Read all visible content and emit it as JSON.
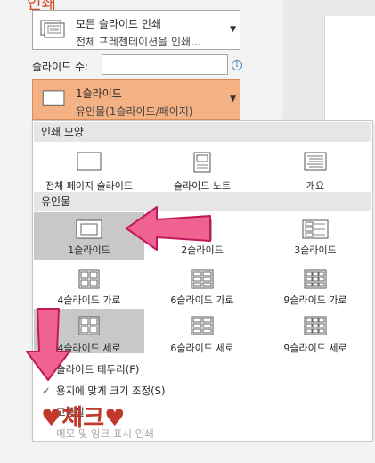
{
  "heading": {
    "text": "인쇄"
  },
  "layout_dropdown": {
    "title": "모든 슬라이드 인쇄",
    "subtitle": "전체 프레젠테이션을 인쇄...",
    "icon": "slides-stack-icon"
  },
  "copies": {
    "label": "슬라이드 수:",
    "value": "",
    "info_icon": "info-icon"
  },
  "handout_dropdown": {
    "title": "1슬라이드",
    "subtitle": "유인물(1슬라이드/페이지)",
    "icon": "single-slide-icon",
    "bg": "#f4b183"
  },
  "popup": {
    "section_print": "인쇄 모양",
    "print_options": [
      {
        "label": "전체 페이지 슬라이드",
        "icon": "full-slide-icon"
      },
      {
        "label": "슬라이드 노트",
        "icon": "notes-page-icon"
      },
      {
        "label": "개요",
        "icon": "outline-icon"
      }
    ],
    "section_handout": "유인물",
    "handout_options": [
      {
        "label": "1슬라이드",
        "icon": "one-slide-icon",
        "selected": true
      },
      {
        "label": "2슬라이드",
        "icon": "two-slides-icon"
      },
      {
        "label": "3슬라이드",
        "icon": "three-slides-icon"
      },
      {
        "label": "4슬라이드 가로",
        "icon": "four-slides-horizontal-icon"
      },
      {
        "label": "6슬라이드 가로",
        "icon": "six-slides-horizontal-icon"
      },
      {
        "label": "9슬라이드 가로",
        "icon": "nine-slides-horizontal-icon"
      },
      {
        "label": "4슬라이드 세로",
        "icon": "four-slides-vertical-icon",
        "selected": true
      },
      {
        "label": "6슬라이드 세로",
        "icon": "six-slides-vertical-icon"
      },
      {
        "label": "9슬라이드 세로",
        "icon": "nine-slides-vertical-icon"
      }
    ],
    "checkbox_options": [
      {
        "label": "슬라이드 테두리(F)",
        "checked": false
      },
      {
        "label": "용지에 맞게 크기 조정(S)",
        "checked": true
      },
      {
        "label": "고품질",
        "checked": false
      },
      {
        "label": "메모 및 잉크 표시 인쇄",
        "checked": false,
        "disabled": true
      }
    ]
  },
  "annotation": {
    "text": "♥체크♥",
    "color": "#c0392b",
    "arrow_color": "#f06292"
  }
}
